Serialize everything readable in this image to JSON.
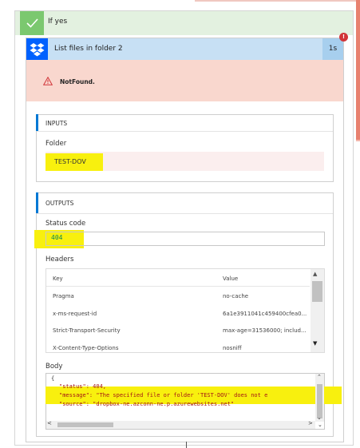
{
  "branch": {
    "title": "If yes",
    "icon": "check-icon",
    "color": "#7bc86f"
  },
  "action": {
    "title": "List files in folder 2",
    "duration": "1s",
    "error_badge": "!",
    "icon": "dropbox-icon",
    "status": {
      "text": "NotFound.",
      "icon": "warning-icon"
    }
  },
  "inputs": {
    "section_title": "INPUTS",
    "folder_label": "Folder",
    "folder_value": "TEST-DOV"
  },
  "outputs": {
    "section_title": "OUTPUTS",
    "status_code_label": "Status code",
    "status_code_value": "404",
    "headers_label": "Headers",
    "headers_table": {
      "columns": [
        "Key",
        "Value"
      ],
      "rows": [
        {
          "key": "Pragma",
          "value": "no-cache"
        },
        {
          "key": "x-ms-request-id",
          "value": "6a1e3911041c459400cfea0..."
        },
        {
          "key": "Strict-Transport-Security",
          "value": "max-age=31536000; includ..."
        },
        {
          "key": "X-Content-Type-Options",
          "value": "nosniff"
        }
      ]
    },
    "body_label": "Body",
    "body_lines": [
      "{",
      "\"status\": 404,",
      "\"message\": \"The specified file or folder 'TEST-DOV' does not e",
      "\"source\": \"dropbox-ne.azconn-ne.p.azurewebsites.net\""
    ]
  },
  "colors": {
    "highlight": "#f8f00e",
    "accent_blue": "#0078d4",
    "error_bg": "#f9d7ce",
    "header_blue": "#c7e0f4",
    "error_red": "#d13438"
  }
}
